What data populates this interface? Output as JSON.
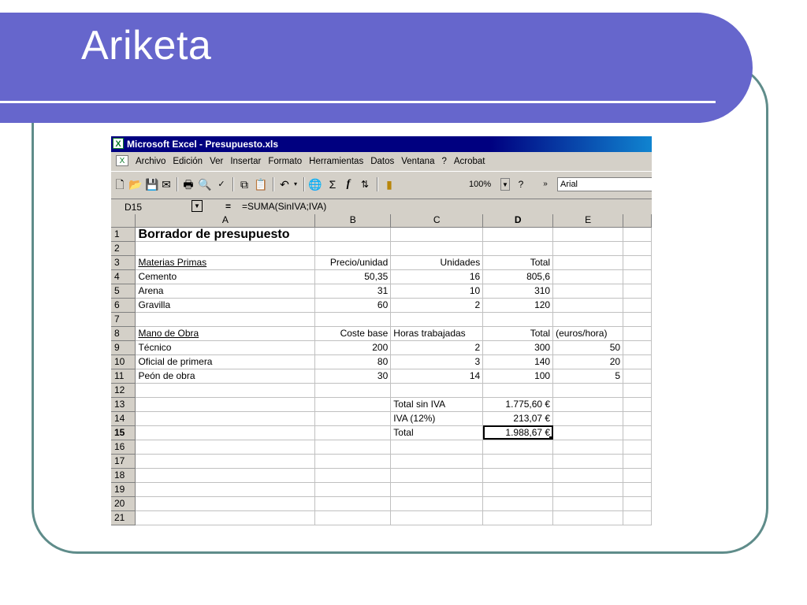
{
  "slide": {
    "title": "Ariketa"
  },
  "excel": {
    "window_title": "Microsoft Excel - Presupuesto.xls",
    "menu": [
      "Archivo",
      "Edición",
      "Ver",
      "Insertar",
      "Formato",
      "Herramientas",
      "Datos",
      "Ventana",
      "?",
      "Acrobat"
    ],
    "toolbar": {
      "zoom": "100%",
      "font": "Arial"
    },
    "name_box": "D15",
    "formula_eq": "=",
    "formula": "=SUMA(SinIVA;IVA)",
    "columns": [
      "A",
      "B",
      "C",
      "D",
      "E"
    ],
    "rows": [
      {
        "n": "1",
        "a": "Borrador de presupuesto",
        "b": "",
        "c": "",
        "d": "",
        "e": ""
      },
      {
        "n": "2",
        "a": "",
        "b": "",
        "c": "",
        "d": "",
        "e": ""
      },
      {
        "n": "3",
        "a": "Materias Primas",
        "b": "Precio/unidad",
        "c": "Unidades",
        "d": "Total",
        "e": ""
      },
      {
        "n": "4",
        "a": "Cemento",
        "b": "50,35",
        "c": "16",
        "d": "805,6",
        "e": ""
      },
      {
        "n": "5",
        "a": "Arena",
        "b": "31",
        "c": "10",
        "d": "310",
        "e": ""
      },
      {
        "n": "6",
        "a": "Gravilla",
        "b": "60",
        "c": "2",
        "d": "120",
        "e": ""
      },
      {
        "n": "7",
        "a": "",
        "b": "",
        "c": "",
        "d": "",
        "e": ""
      },
      {
        "n": "8",
        "a": "Mano de Obra",
        "b": "Coste base",
        "c": "Horas trabajadas",
        "d": "Total",
        "e": "(euros/hora)"
      },
      {
        "n": "9",
        "a": "Técnico",
        "b": "200",
        "c": "2",
        "d": "300",
        "e": "50"
      },
      {
        "n": "10",
        "a": "Oficial de primera",
        "b": "80",
        "c": "3",
        "d": "140",
        "e": "20"
      },
      {
        "n": "11",
        "a": "Peón de obra",
        "b": "30",
        "c": "14",
        "d": "100",
        "e": "5"
      },
      {
        "n": "12",
        "a": "",
        "b": "",
        "c": "",
        "d": "",
        "e": ""
      },
      {
        "n": "13",
        "a": "",
        "b": "",
        "c": "Total sin IVA",
        "d": "1.775,60 €",
        "e": ""
      },
      {
        "n": "14",
        "a": "",
        "b": "",
        "c": "IVA (12%)",
        "d": "213,07 €",
        "e": ""
      },
      {
        "n": "15",
        "a": "",
        "b": "",
        "c": "Total",
        "d": "1.988,67 €",
        "e": ""
      },
      {
        "n": "16",
        "a": "",
        "b": "",
        "c": "",
        "d": "",
        "e": ""
      },
      {
        "n": "17",
        "a": "",
        "b": "",
        "c": "",
        "d": "",
        "e": ""
      },
      {
        "n": "18",
        "a": "",
        "b": "",
        "c": "",
        "d": "",
        "e": ""
      },
      {
        "n": "19",
        "a": "",
        "b": "",
        "c": "",
        "d": "",
        "e": ""
      },
      {
        "n": "20",
        "a": "",
        "b": "",
        "c": "",
        "d": "",
        "e": ""
      },
      {
        "n": "21",
        "a": "",
        "b": "",
        "c": "",
        "d": "",
        "e": ""
      }
    ]
  }
}
